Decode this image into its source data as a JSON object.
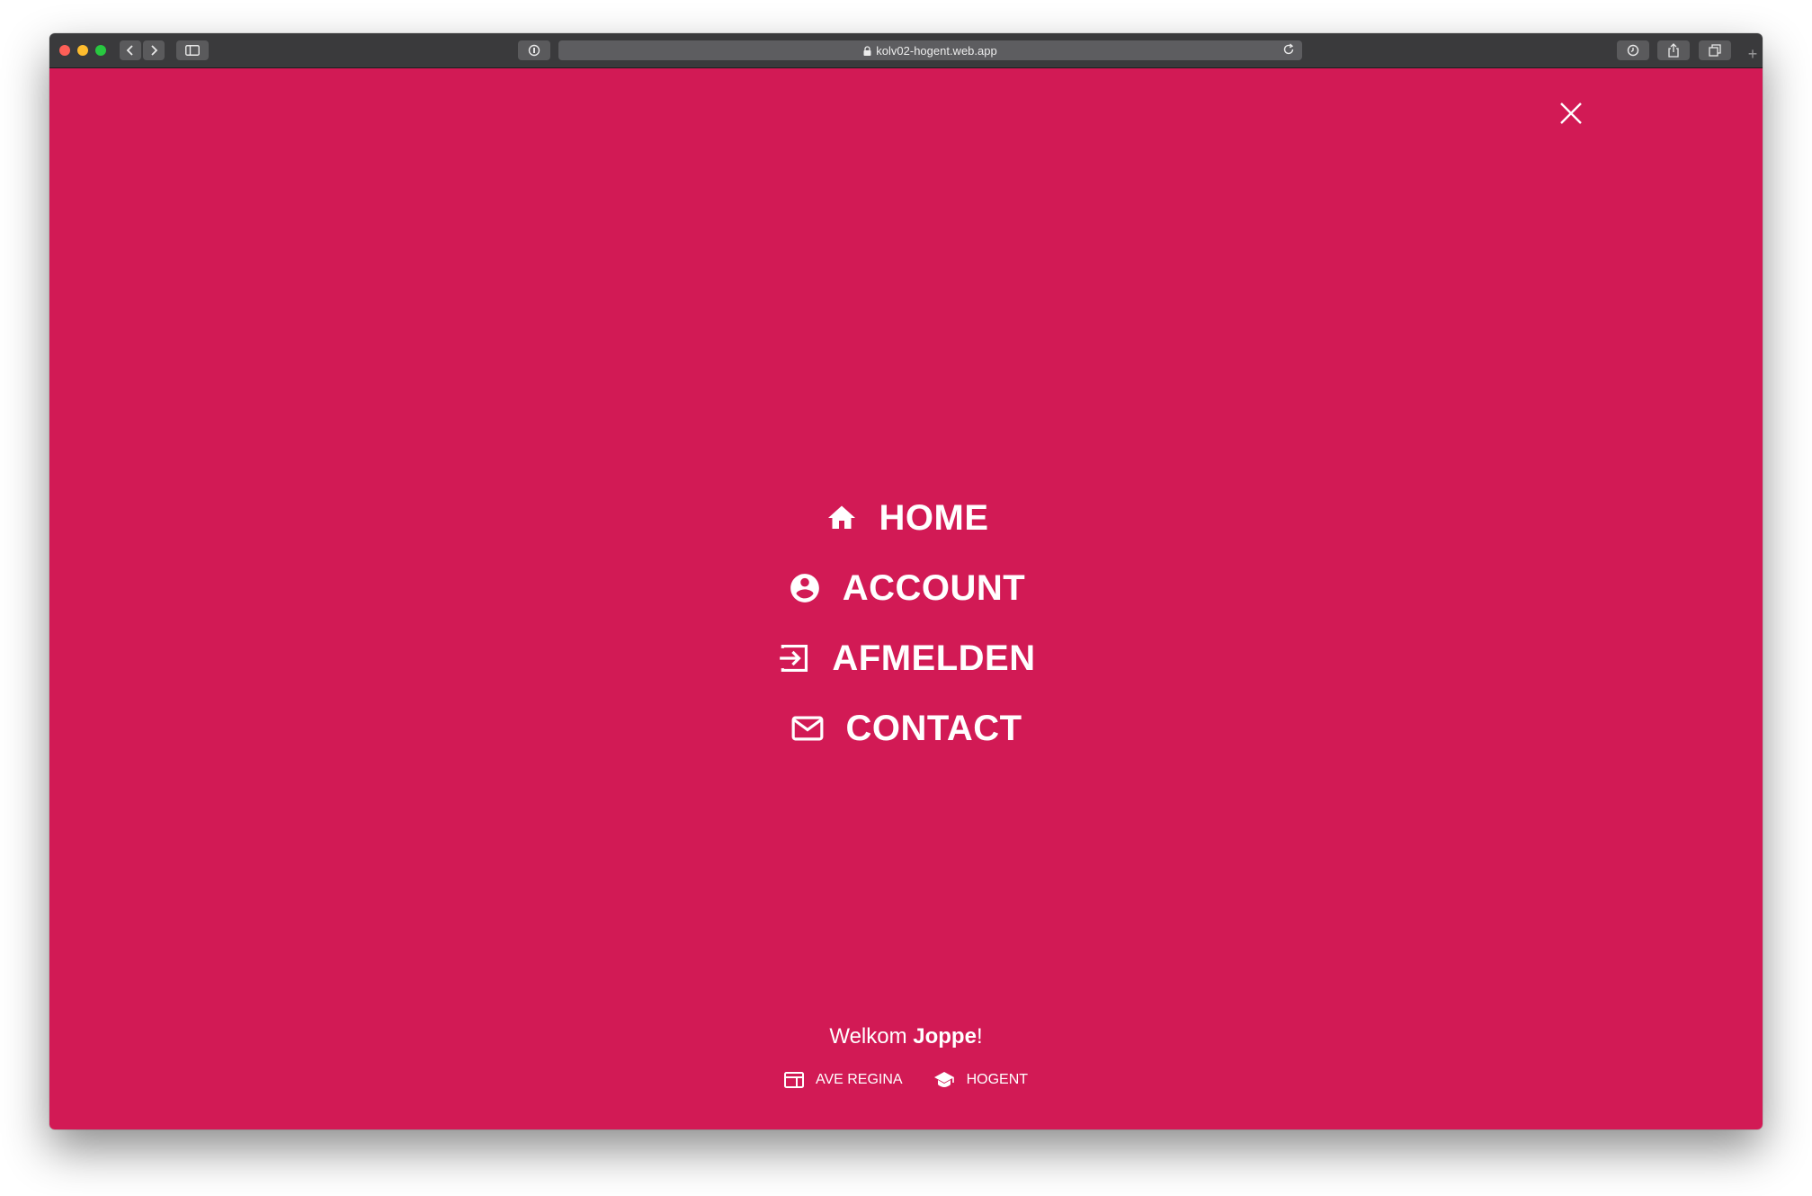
{
  "browser": {
    "url": "kolv02-hogent.web.app"
  },
  "menu": {
    "items": [
      {
        "label": "HOME",
        "icon": "home-icon"
      },
      {
        "label": "ACCOUNT",
        "icon": "account-circle-icon"
      },
      {
        "label": "AFMELDEN",
        "icon": "logout-icon"
      },
      {
        "label": "CONTACT",
        "icon": "mail-icon"
      }
    ]
  },
  "welcome": {
    "prefix": "Welkom ",
    "name": "Joppe",
    "suffix": "!"
  },
  "footer": {
    "links": [
      {
        "label": "AVE REGINA",
        "icon": "web-icon"
      },
      {
        "label": "HOGENT",
        "icon": "school-icon"
      }
    ]
  },
  "colors": {
    "background": "#d21a55",
    "text": "#ffffff"
  }
}
